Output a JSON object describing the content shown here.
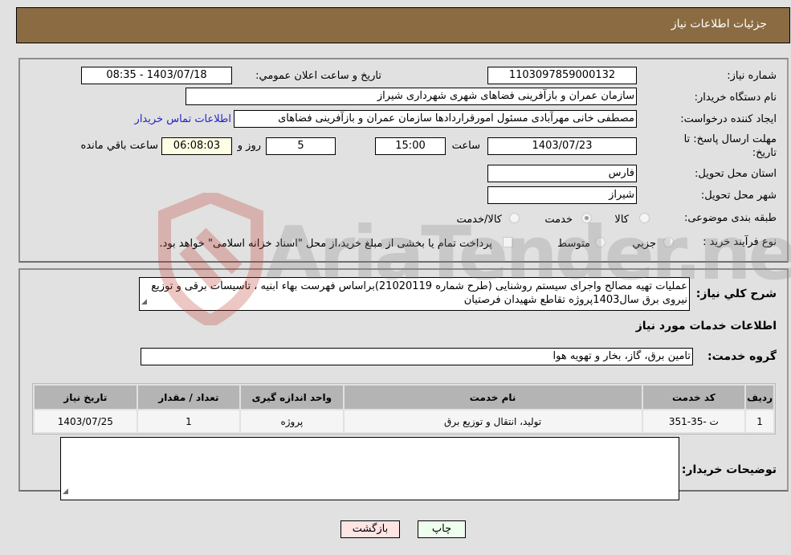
{
  "header": {
    "title": "جزئيات اطلاعات نياز"
  },
  "fields": {
    "need_number": {
      "label": "شماره نياز:",
      "value": "1103097859000132"
    },
    "announce_datetime": {
      "label": "تاريخ و ساعت اعلان عمومي:",
      "value": "1403/07/18 - 08:35"
    },
    "buyer_org": {
      "label": "نام دستگاه خريدار:",
      "value": "سازمان عمران و بازآفرینی فضاهای شهری شهرداری شیراز"
    },
    "requester": {
      "label": "ايجاد کننده درخواست:",
      "value": "مصطفی خانی مهرآبادی مسئول امورقراردادها سازمان عمران و بازآفرینی فضاهای",
      "contact_link": "اطلاعات تماس خريدار"
    },
    "deadline": {
      "label_line1": "مهلت ارسال پاسخ: تا",
      "label_line2": "تاريخ:",
      "date": "1403/07/23",
      "time_label": "ساعت",
      "time": "15:00",
      "days": "5",
      "days_label": "روز و",
      "remaining": "06:08:03",
      "remaining_label": "ساعت باقي مانده"
    },
    "province": {
      "label": "استان محل تحويل:",
      "value": "فارس"
    },
    "city": {
      "label": "شهر محل تحويل:",
      "value": "شیراز"
    },
    "category": {
      "label": "طبقه بندی موضوعی:",
      "options": [
        {
          "label": "کالا",
          "selected": false
        },
        {
          "label": "خدمت",
          "selected": true
        },
        {
          "label": "کالا/خدمت",
          "selected": false
        }
      ]
    },
    "purchase_type": {
      "label": "نوع فرآيند خريد :",
      "options": [
        {
          "label": "جزيي",
          "selected": false
        },
        {
          "label": "متوسط",
          "selected": false
        }
      ],
      "treasury_note": "پرداخت تمام یا بخشی از مبلغ خرید،از محل \"اسناد خزانه اسلامی\" خواهد بود."
    }
  },
  "description": {
    "label": "شرح کلي نياز:",
    "text": "عملیات تهیه مصالح واجرای سیستم روشنایی (طرح شماره 21020119)براساس فهرست بهاء ابنیه ، تاسیسات برقی و توزیع نیروی برق سال1403پروژه تقاطع شهیدان فرصتیان"
  },
  "services": {
    "section_title": "اطلاعات خدمات مورد نياز",
    "group_label": "گروه خدمت:",
    "group_value": "تامین برق، گاز، بخار و تهویه هوا",
    "table": {
      "headers": [
        "رديف",
        "کد خدمت",
        "نام خدمت",
        "واحد اندازه گيری",
        "تعداد / مقدار",
        "تاريخ نياز"
      ],
      "rows": [
        [
          "1",
          "ت -35-351",
          "تولید، انتقال و توزیع برق",
          "پروژه",
          "1",
          "1403/07/25"
        ]
      ]
    }
  },
  "buyer_notes": {
    "label": "توضيحات خريدار:",
    "value": ""
  },
  "buttons": {
    "print": "چاپ",
    "back": "بازگشت"
  },
  "watermark": {
    "text": "AriaTender.neT"
  },
  "colors": {
    "header_bg": "#8b6c42",
    "link": "#2323c8",
    "print_bg": "#eeffee",
    "back_bg": "#ffe4e4"
  }
}
